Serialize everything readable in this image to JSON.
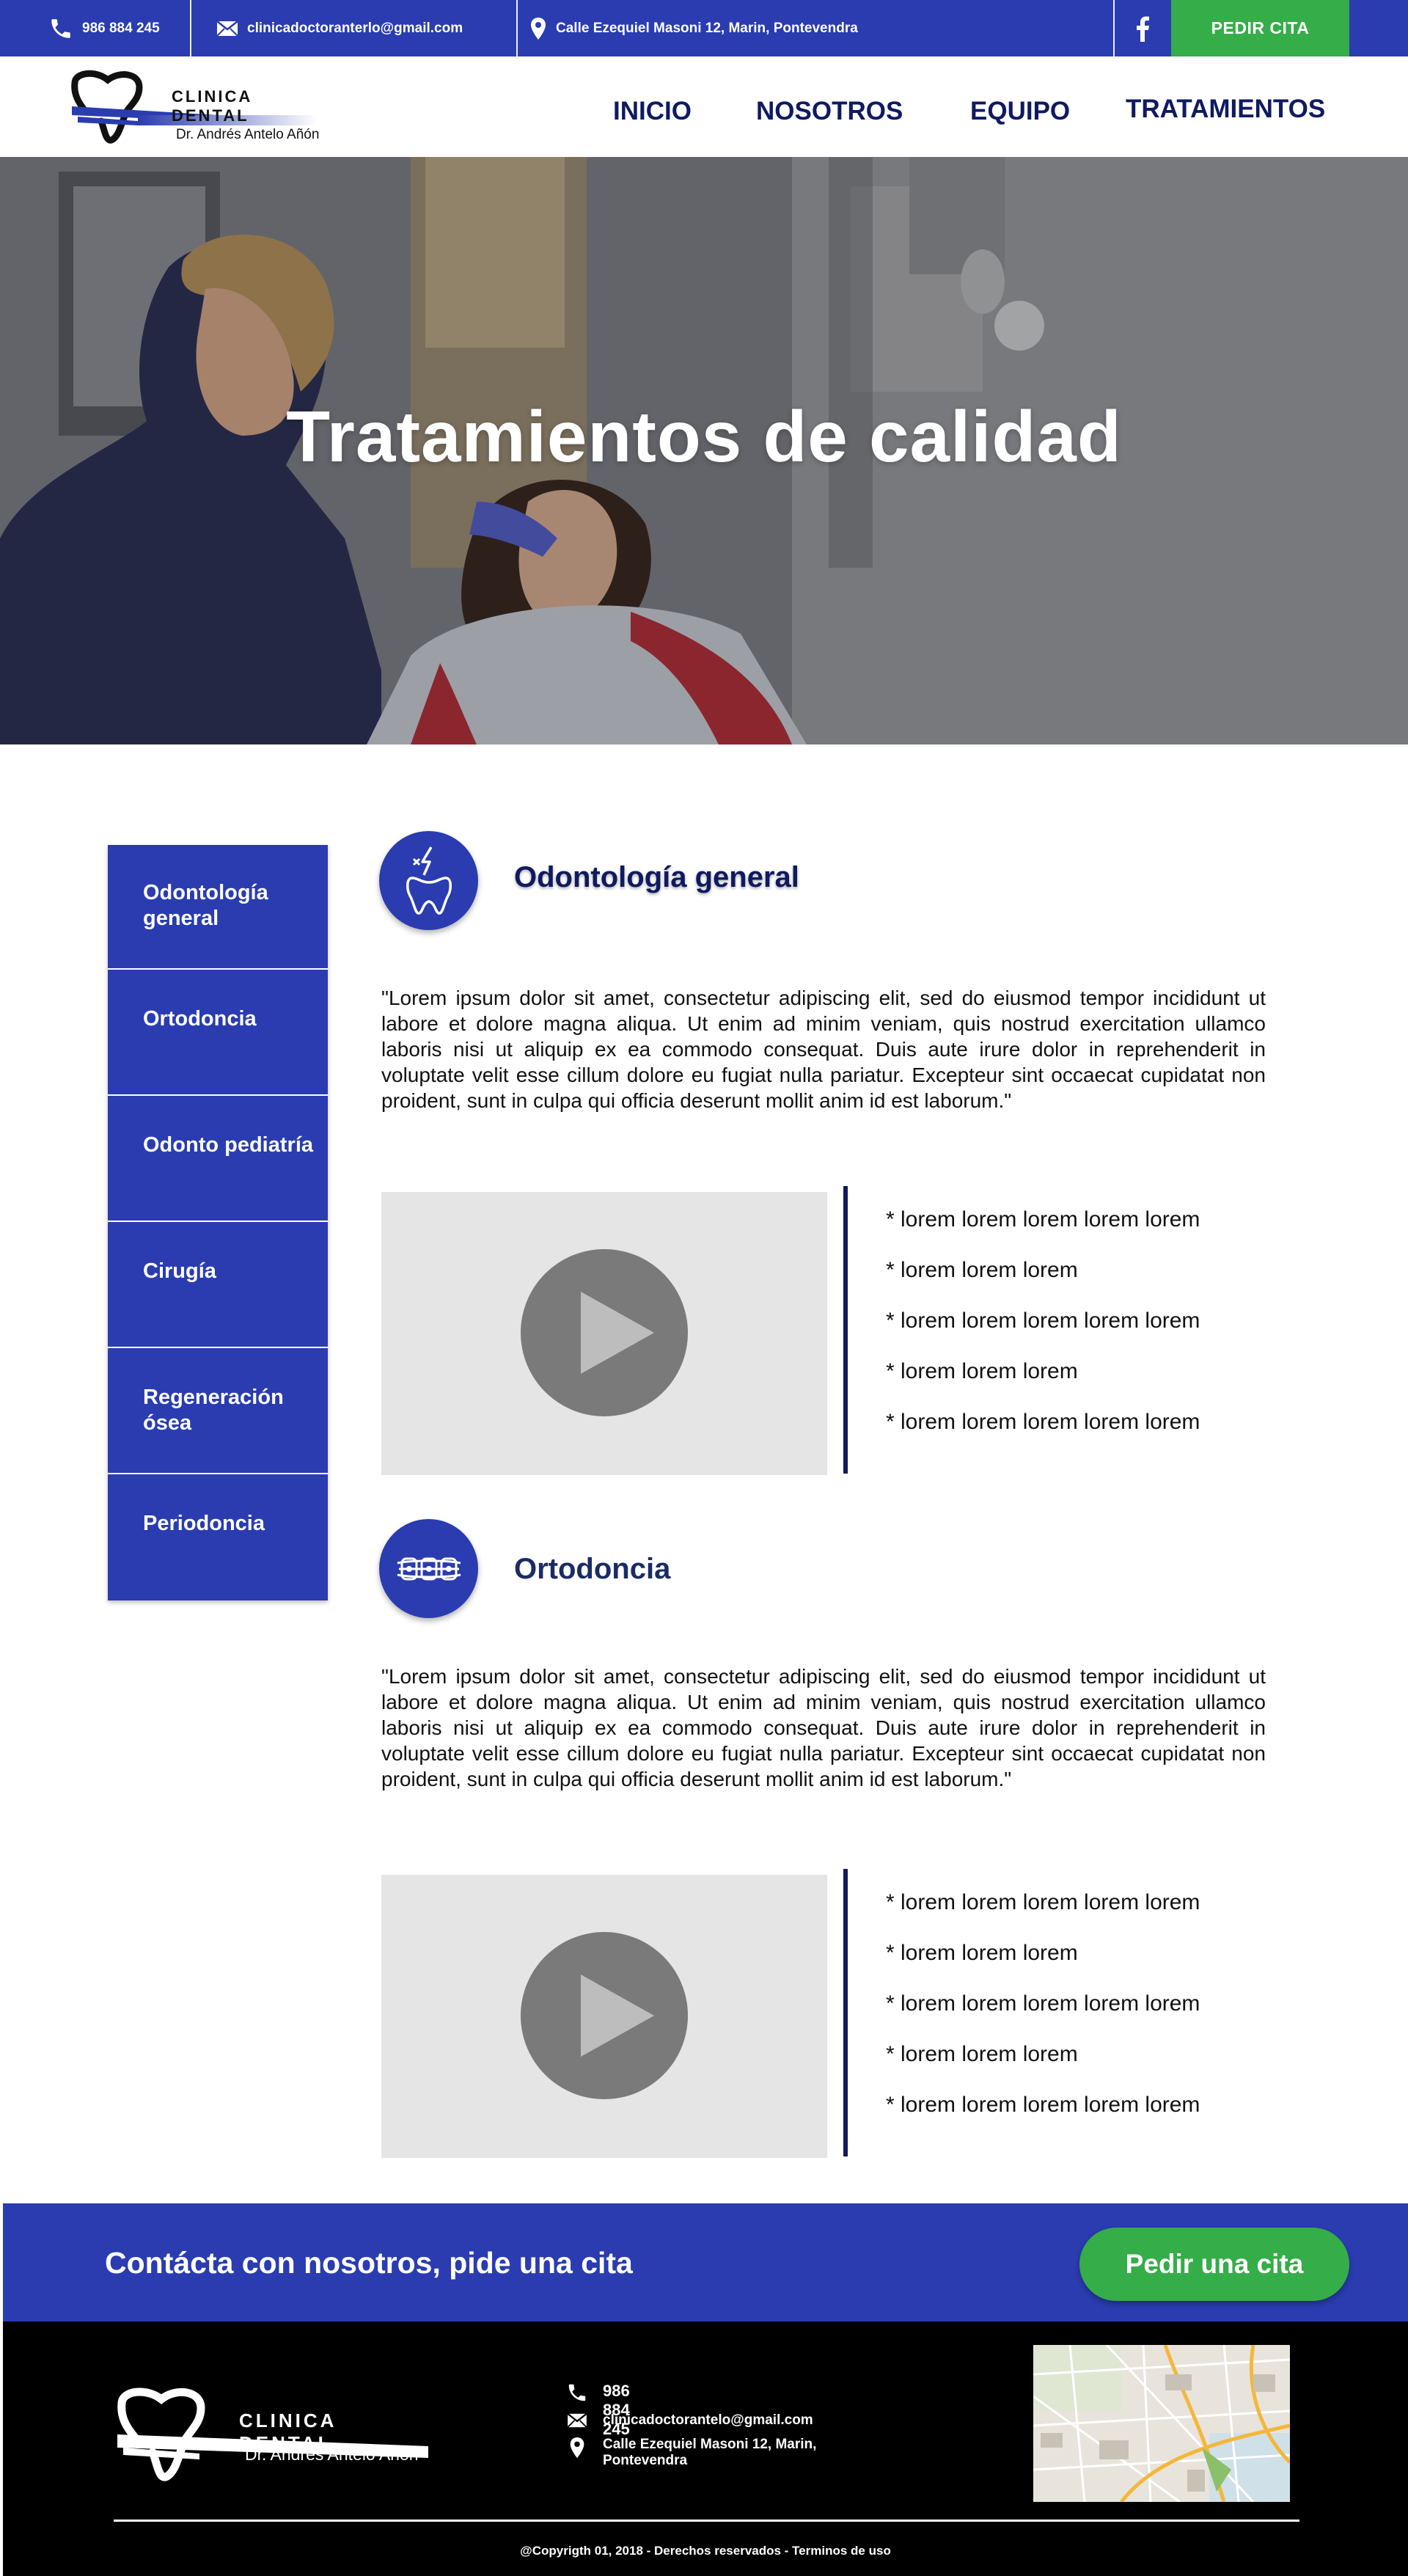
{
  "topbar": {
    "phone": "986 884 245",
    "email": "clinicadoctoranterlo@gmail.com",
    "address": "Calle Ezequiel Masoni 12, Marin, Pontevendra",
    "social_icon": "facebook-icon",
    "cta_label": "PEDIR CITA"
  },
  "header": {
    "logo_brand": "CLINICA DENTAL",
    "logo_doctor": "Dr. Andrés Antelo Añón",
    "nav": [
      "INICIO",
      "NOSOTROS",
      "EQUIPO",
      "TRATAMIENTOS"
    ]
  },
  "hero": {
    "title": "Tratamientos de calidad"
  },
  "sidebar": {
    "items": [
      "Odontología general",
      "Ortodoncia",
      "Odonto pediatría",
      "Cirugía",
      "Regeneración ósea",
      "Periodoncia"
    ]
  },
  "treatments": [
    {
      "icon": "tooth-pain-icon",
      "title": "Odontología general",
      "description": "\"Lorem ipsum dolor sit amet, consectetur adipiscing elit, sed do eiusmod tempor incididunt ut labore et dolore magna aliqua. Ut enim ad minim veniam, quis nostrud exercitation ullamco laboris nisi ut aliquip ex ea commodo consequat. Duis aute irure dolor in reprehenderit in voluptate velit esse cillum dolore eu fugiat nulla pariatur. Excepteur sint occaecat cupidatat non proident, sunt in culpa qui officia deserunt mollit anim id est laborum.\"",
      "list": [
        "* lorem  lorem lorem lorem lorem",
        "* lorem lorem lorem",
        "* lorem  lorem lorem lorem lorem",
        "* lorem lorem lorem",
        "* lorem  lorem lorem lorem lorem"
      ]
    },
    {
      "icon": "braces-icon",
      "title": "Ortodoncia",
      "description": "\"Lorem ipsum dolor sit amet, consectetur adipiscing elit, sed do eiusmod tempor incididunt ut labore et dolore magna aliqua. Ut enim ad minim veniam, quis nostrud exercitation ullamco laboris nisi ut aliquip ex ea commodo consequat. Duis aute irure dolor in reprehenderit in voluptate velit esse cillum dolore eu fugiat nulla pariatur. Excepteur sint occaecat cupidatat non proident, sunt in culpa qui officia deserunt mollit anim id est laborum.\"",
      "list": [
        "* lorem  lorem lorem lorem lorem",
        "* lorem lorem lorem",
        "* lorem  lorem lorem lorem lorem",
        "* lorem lorem lorem",
        "* lorem  lorem lorem lorem lorem"
      ]
    }
  ],
  "contact": {
    "text": "Contácta con nosotros, pide una cita",
    "button": "Pedir una cita"
  },
  "footer": {
    "logo_brand": "CLINICA DENTAL",
    "logo_doctor": "Dr. Andrés Antelo Añón",
    "phone": "986 884 245",
    "email": "clinicadoctorantelo@gmail.com",
    "address": "Calle Ezequiel Masoni 12, Marin, Pontevendra",
    "copyright": "@Copyrigth 01, 2018 - Derechos reservados - Terminos de uso"
  },
  "colors": {
    "brand_blue": "#2a3cb0",
    "navy": "#0f1a60",
    "cta_green": "#35ad48",
    "footer_bg": "#000000"
  }
}
